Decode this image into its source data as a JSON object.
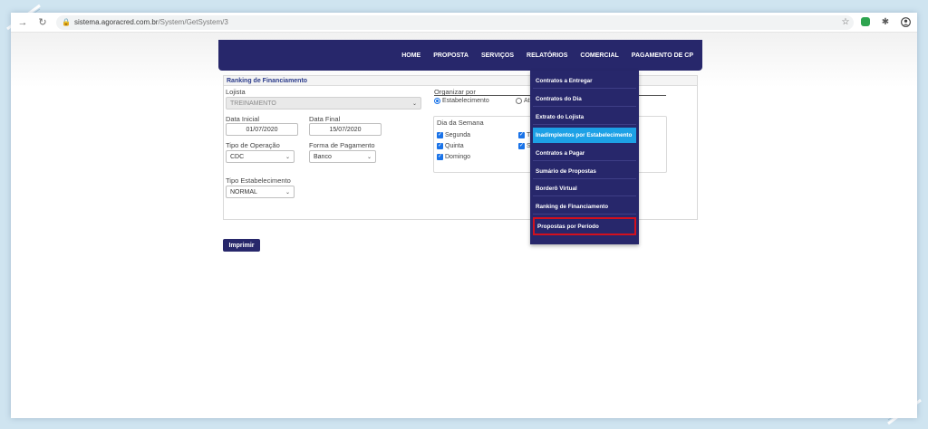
{
  "browser": {
    "url_host": "sistema.agoracred.com.br",
    "url_path": "/System/GetSystem/3"
  },
  "nav": {
    "items": [
      "HOME",
      "PROPOSTA",
      "SERVIÇOS",
      "RELATÓRIOS",
      "COMERCIAL",
      "PAGAMENTO DE CP"
    ]
  },
  "panel": {
    "title": "Ranking de Financiamento",
    "lojista_label": "Lojista",
    "lojista_value": "TREINAMENTO",
    "data_inicial_label": "Data Inicial",
    "data_inicial_value": "01/07/2020",
    "data_final_label": "Data Final",
    "data_final_value": "15/07/2020",
    "tipo_operacao_label": "Tipo de Operação",
    "tipo_operacao_value": "CDC",
    "forma_pagamento_label": "Forma de Pagamento",
    "forma_pagamento_value": "Banco",
    "tipo_estab_label": "Tipo Estabelecimento",
    "tipo_estab_value": "NORMAL",
    "organizar_label": "Organizar por",
    "organizar_opt1": "Estabelecimento",
    "organizar_opt2": "At",
    "dia_semana_label": "Dia da Semana",
    "dias": [
      "Segunda",
      "T",
      "Quinta",
      "S",
      "Domingo"
    ]
  },
  "print_button": "Imprimir",
  "dropdown": {
    "items": [
      "Contratos a Entregar",
      "Contratos do Dia",
      "Extrato do Lojista",
      "Inadimplentos por Estabelecimento",
      "Contratos a Pagar",
      "Sumário de Propostas",
      "Borderô Virtual",
      "Ranking de Financiamento",
      "Propostas por Período"
    ],
    "active_index": 3,
    "outlined_index": 8
  },
  "colors": {
    "navbar": "#27276b",
    "active_item": "#1da1e6",
    "outline": "#d2101e",
    "background": "#cfe4f0"
  }
}
